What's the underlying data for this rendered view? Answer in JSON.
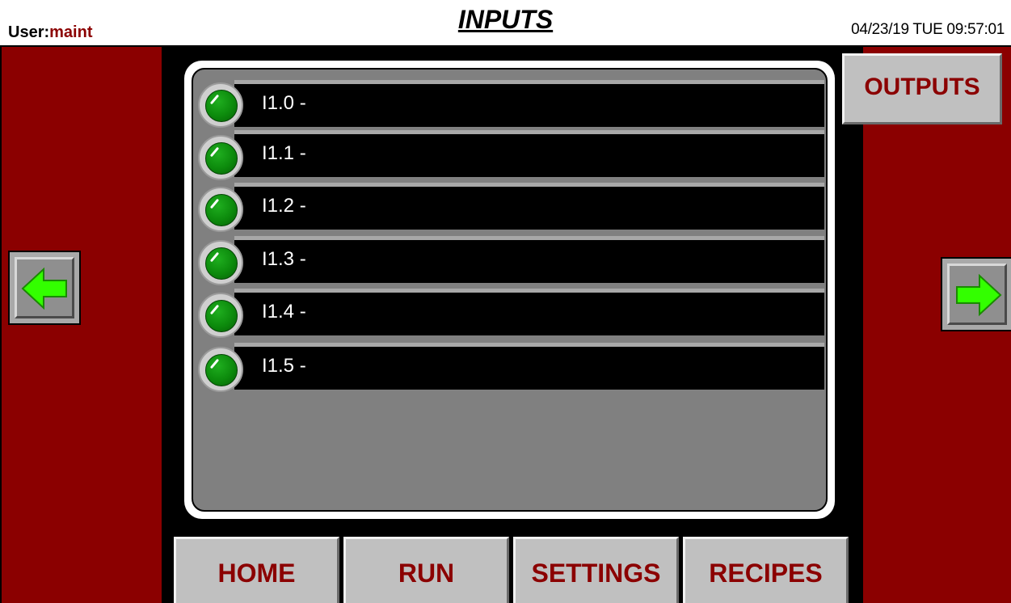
{
  "header": {
    "user_label": "User:",
    "user_name": "maint",
    "title": "INPUTS",
    "datetime": "04/23/19 TUE  09:57:01"
  },
  "inputs": [
    {
      "label": "I1.0 -",
      "state": "on"
    },
    {
      "label": "I1.1 -",
      "state": "on"
    },
    {
      "label": "I1.2 -",
      "state": "on"
    },
    {
      "label": "I1.3 -",
      "state": "on"
    },
    {
      "label": "I1.4 -",
      "state": "on"
    },
    {
      "label": "I1.5 -",
      "state": "on"
    }
  ],
  "buttons": {
    "outputs": "OUTPUTS",
    "prev_icon": "left-arrow-icon",
    "next_icon": "right-arrow-icon"
  },
  "nav": {
    "home": "HOME",
    "run": "RUN",
    "settings": "SETTINGS",
    "recipes": "RECIPES"
  },
  "colors": {
    "side_panel": "#8b0000",
    "label_red": "#8b0000",
    "led_on": "#0c8a0c",
    "arrow": "#33ff00"
  }
}
